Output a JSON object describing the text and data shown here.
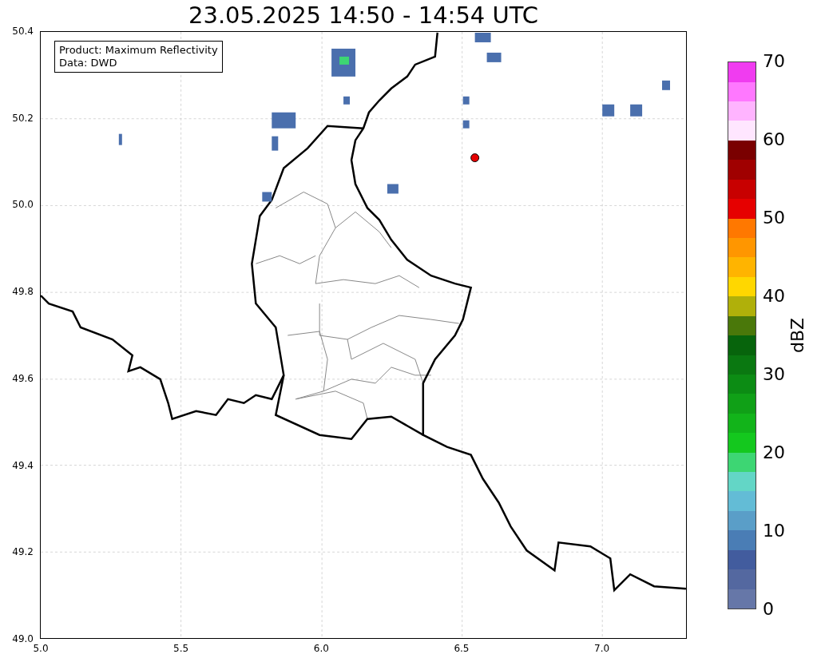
{
  "title": "23.05.2025 14:50 - 14:54 UTC",
  "map": {
    "legend": [
      "Product: Maximum Reflectivity",
      "Data: DWD"
    ],
    "x_ticks": [
      "5.0",
      "5.5",
      "6.0",
      "6.5",
      "7.0"
    ],
    "y_ticks": [
      "50.4",
      "50.2",
      "50.0",
      "49.8",
      "49.6",
      "49.4",
      "49.2",
      "49.0"
    ]
  },
  "colorbar": {
    "label": "dBZ",
    "ticks": [
      "70",
      "60",
      "50",
      "40",
      "30",
      "20",
      "10",
      "0"
    ],
    "segments": [
      {
        "color": "#6677a8"
      },
      {
        "color": "#5468a0"
      },
      {
        "color": "#425c9e"
      },
      {
        "color": "#4a7db5"
      },
      {
        "color": "#5a9ec8"
      },
      {
        "color": "#63bcd6"
      },
      {
        "color": "#63d6c6"
      },
      {
        "color": "#3dd673"
      },
      {
        "color": "#14c81e"
      },
      {
        "color": "#12b41a"
      },
      {
        "color": "#10a017"
      },
      {
        "color": "#0c8c14"
      },
      {
        "color": "#0a7811"
      },
      {
        "color": "#07640c"
      },
      {
        "color": "#4a780a"
      },
      {
        "color": "#b0b00a"
      },
      {
        "color": "#ffd700"
      },
      {
        "color": "#ffb400"
      },
      {
        "color": "#ff9600"
      },
      {
        "color": "#ff7800"
      },
      {
        "color": "#e60000"
      },
      {
        "color": "#c80000"
      },
      {
        "color": "#a00000"
      },
      {
        "color": "#7a0000"
      },
      {
        "color": "#ffe6ff"
      },
      {
        "color": "#ffb4ff"
      },
      {
        "color": "#ff78ff"
      },
      {
        "color": "#f03cf0"
      }
    ]
  }
}
